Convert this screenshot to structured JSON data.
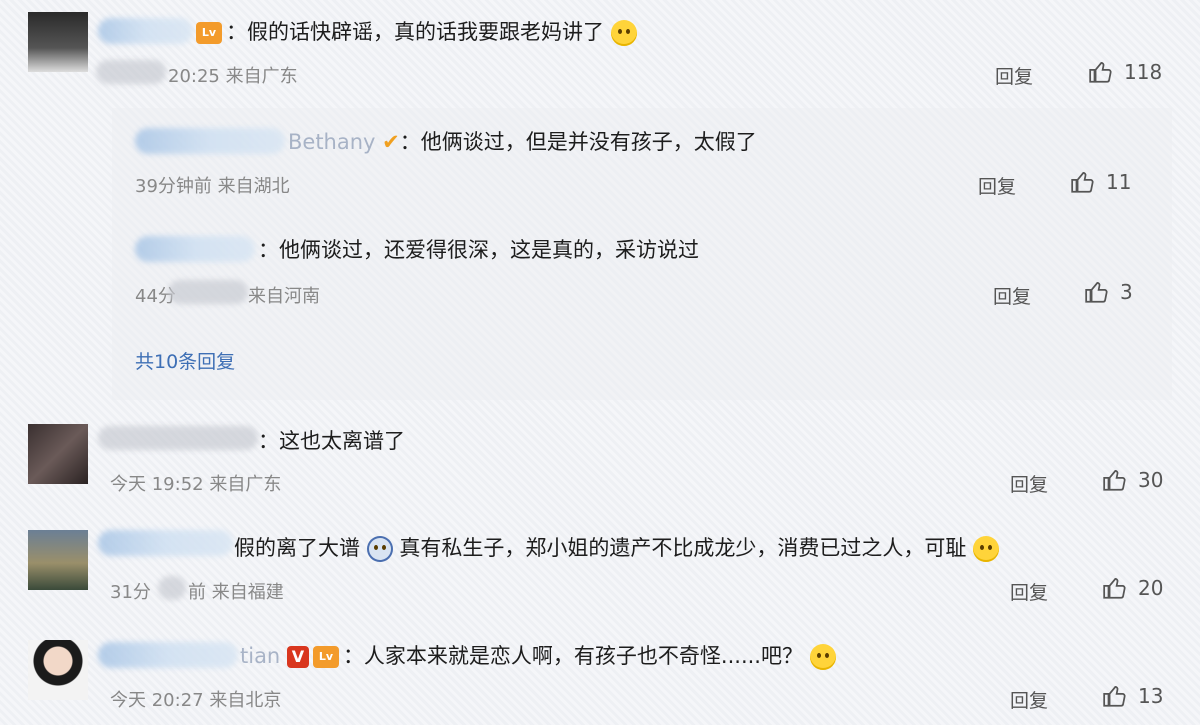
{
  "comments": [
    {
      "text": "：假的话快辟谣，真的话我要跟老妈讲了",
      "time": "20:25 来自广东",
      "reply": "回复",
      "likes": "118"
    },
    {
      "user_partial": "Bethany",
      "text": "：他俩谈过，但是并没有孩子，太假了",
      "time": "39分钟前 来自湖北",
      "reply": "回复",
      "likes": "11"
    },
    {
      "text": "：他俩谈过，还爱得很深，这是真的，采访说过",
      "time": "44分",
      "time_suffix": "来自河南",
      "reply": "回复",
      "likes": "3"
    },
    {
      "text": "：这也太离谱了",
      "time": "今天 19:52 来自广东",
      "reply": "回复",
      "likes": "30"
    },
    {
      "text_a": "假的离了大谱",
      "text_b": "真有私生子，郑小姐的遗产不比成龙少，消费已过之人，可耻",
      "time": "31分",
      "time_suffix": "前 来自福建",
      "reply": "回复",
      "likes": "20"
    },
    {
      "user_partial": "tian",
      "text": "：人家本来就是恋人啊，有孩子也不奇怪......吧？",
      "time": "今天 20:27 来自北京",
      "reply": "回复",
      "likes": "13"
    }
  ],
  "more_replies": "共10条回复"
}
